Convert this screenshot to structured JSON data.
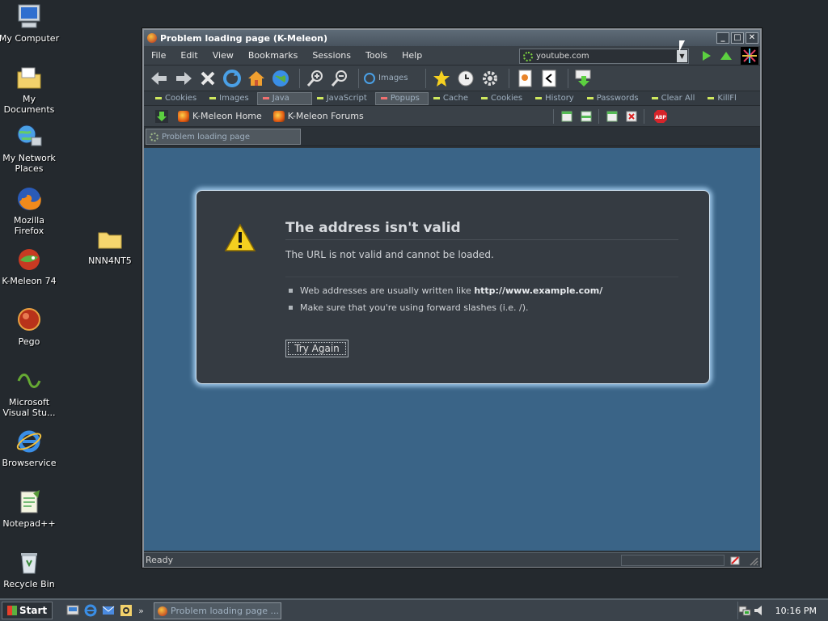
{
  "desktop": {
    "icons": [
      {
        "label": "My Computer",
        "icon": "my-computer-icon"
      },
      {
        "label": "My Documents",
        "icon": "my-documents-icon"
      },
      {
        "label": "My Network Places",
        "icon": "network-places-icon"
      },
      {
        "label": "Mozilla Firefox",
        "icon": "firefox-icon"
      },
      {
        "label": "K-Meleon 74",
        "icon": "k-meleon-icon"
      },
      {
        "label": "Pego",
        "icon": "pego-icon"
      },
      {
        "label": "Microsoft Visual Stu...",
        "icon": "visual-studio-icon"
      },
      {
        "label": "Browservice",
        "icon": "internet-explorer-icon"
      },
      {
        "label": "Notepad++",
        "icon": "notepad-plus-plus-icon"
      },
      {
        "label": "Recycle Bin",
        "icon": "recycle-bin-icon"
      },
      {
        "label": "NNN4NT5",
        "icon": "folder-icon"
      }
    ]
  },
  "window": {
    "title": "Problem loading page (K-Meleon)",
    "menu": [
      "File",
      "Edit",
      "View",
      "Bookmarks",
      "Sessions",
      "Tools",
      "Help"
    ],
    "url": "youtube.com",
    "toolbar": {
      "images_label": "Images"
    },
    "privacy_bar": [
      "Cookies",
      "Images",
      "Java",
      "JavaScript",
      "Popups",
      "Cache",
      "Cookies",
      "History",
      "Passwords",
      "Clear All",
      "KillFl"
    ],
    "links": [
      "K-Meleon Home",
      "K-Meleon Forums"
    ],
    "tab_label": "Problem loading page",
    "status": "Ready"
  },
  "error_page": {
    "title": "The address isn't valid",
    "subtitle": "The URL is not valid and cannot be loaded.",
    "bullet1_text": "Web addresses are usually written like ",
    "bullet1_bold": "http://www.example.com/",
    "bullet2": "Make sure that you're using forward slashes (i.e. /).",
    "button": "Try Again"
  },
  "taskbar": {
    "start_label": "Start",
    "task_label": "Problem loading page ...",
    "clock": "10:16 PM"
  },
  "colors": {
    "page_bg": "#3a6487",
    "error_box": "#353b42",
    "glow": "#9cc6e8"
  }
}
